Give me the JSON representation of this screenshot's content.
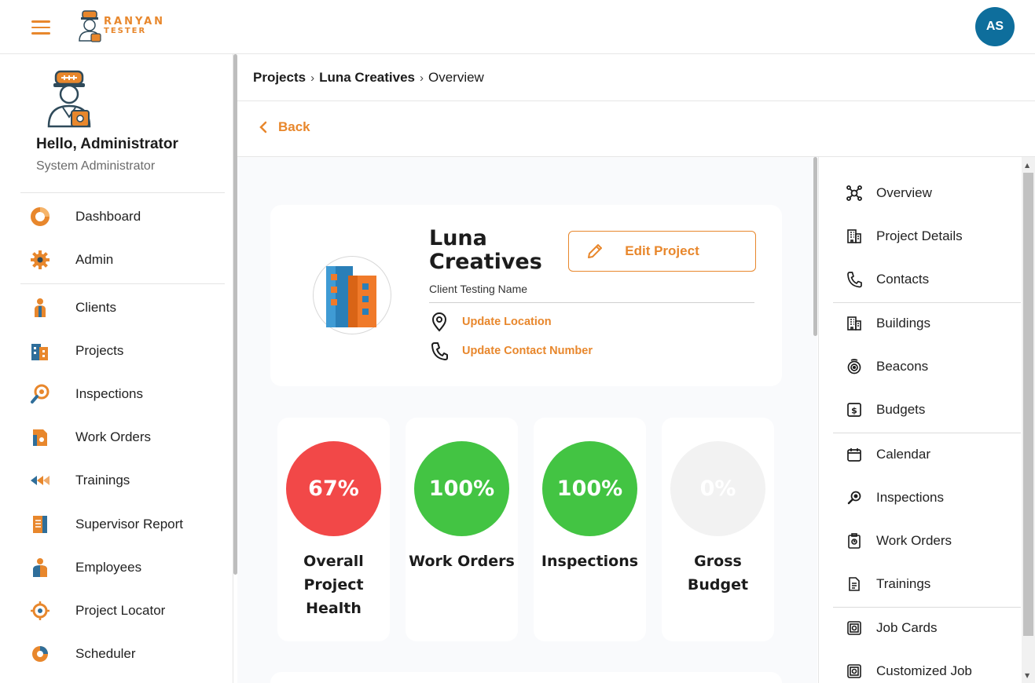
{
  "app": {
    "logo_line1": "RANYAN",
    "logo_line2": "TESTER",
    "user_initials": "AS",
    "accent_color": "#e8872c",
    "avatar_color": "#0e6e9c"
  },
  "sidebar": {
    "greeting": "Hello, Administrator",
    "role": "System Administrator",
    "items": [
      {
        "label": "Dashboard",
        "icon": "dashboard-donut-icon"
      },
      {
        "label": "Admin",
        "icon": "gear-icon"
      },
      {
        "label": "Clients",
        "icon": "person-icon"
      },
      {
        "label": "Projects",
        "icon": "buildings-icon"
      },
      {
        "label": "Inspections",
        "icon": "magnifier-icon"
      },
      {
        "label": "Work Orders",
        "icon": "work-order-icon"
      },
      {
        "label": "Trainings",
        "icon": "trainings-icon"
      },
      {
        "label": "Supervisor Report",
        "icon": "report-icon"
      },
      {
        "label": "Employees",
        "icon": "employees-icon"
      },
      {
        "label": "Project Locator",
        "icon": "locator-icon"
      },
      {
        "label": "Scheduler",
        "icon": "scheduler-icon"
      }
    ]
  },
  "breadcrumb": {
    "items": [
      "Projects",
      "Luna Creatives",
      "Overview"
    ]
  },
  "back_label": "Back",
  "project": {
    "name": "Luna Creatives",
    "client": "Client Testing Name",
    "edit_label": "Edit Project",
    "update_location": "Update Location",
    "update_contact": "Update Contact Number"
  },
  "stats": [
    {
      "value": "67%",
      "label": "Overall Project Health",
      "color": "#f24848"
    },
    {
      "value": "100%",
      "label": "Work Orders",
      "color": "#43c443"
    },
    {
      "value": "100%",
      "label": "Inspections",
      "color": "#43c443"
    },
    {
      "value": "0%",
      "label": "Gross Budget",
      "color": "#f2f2f2"
    }
  ],
  "rightnav": {
    "items": [
      {
        "label": "Overview",
        "icon": "network-icon"
      },
      {
        "label": "Project Details",
        "icon": "building-icon"
      },
      {
        "label": "Contacts",
        "icon": "phone-icon"
      },
      {
        "label": "Buildings",
        "icon": "building-icon"
      },
      {
        "label": "Beacons",
        "icon": "beacon-icon"
      },
      {
        "label": "Budgets",
        "icon": "dollar-icon"
      },
      {
        "label": "Calendar",
        "icon": "calendar-icon"
      },
      {
        "label": "Inspections",
        "icon": "magnifier-icon"
      },
      {
        "label": "Work Orders",
        "icon": "clipboard-icon"
      },
      {
        "label": "Trainings",
        "icon": "document-icon"
      },
      {
        "label": "Job Cards",
        "icon": "job-card-icon"
      },
      {
        "label": "Customized Job",
        "icon": "job-card-icon"
      }
    ]
  }
}
